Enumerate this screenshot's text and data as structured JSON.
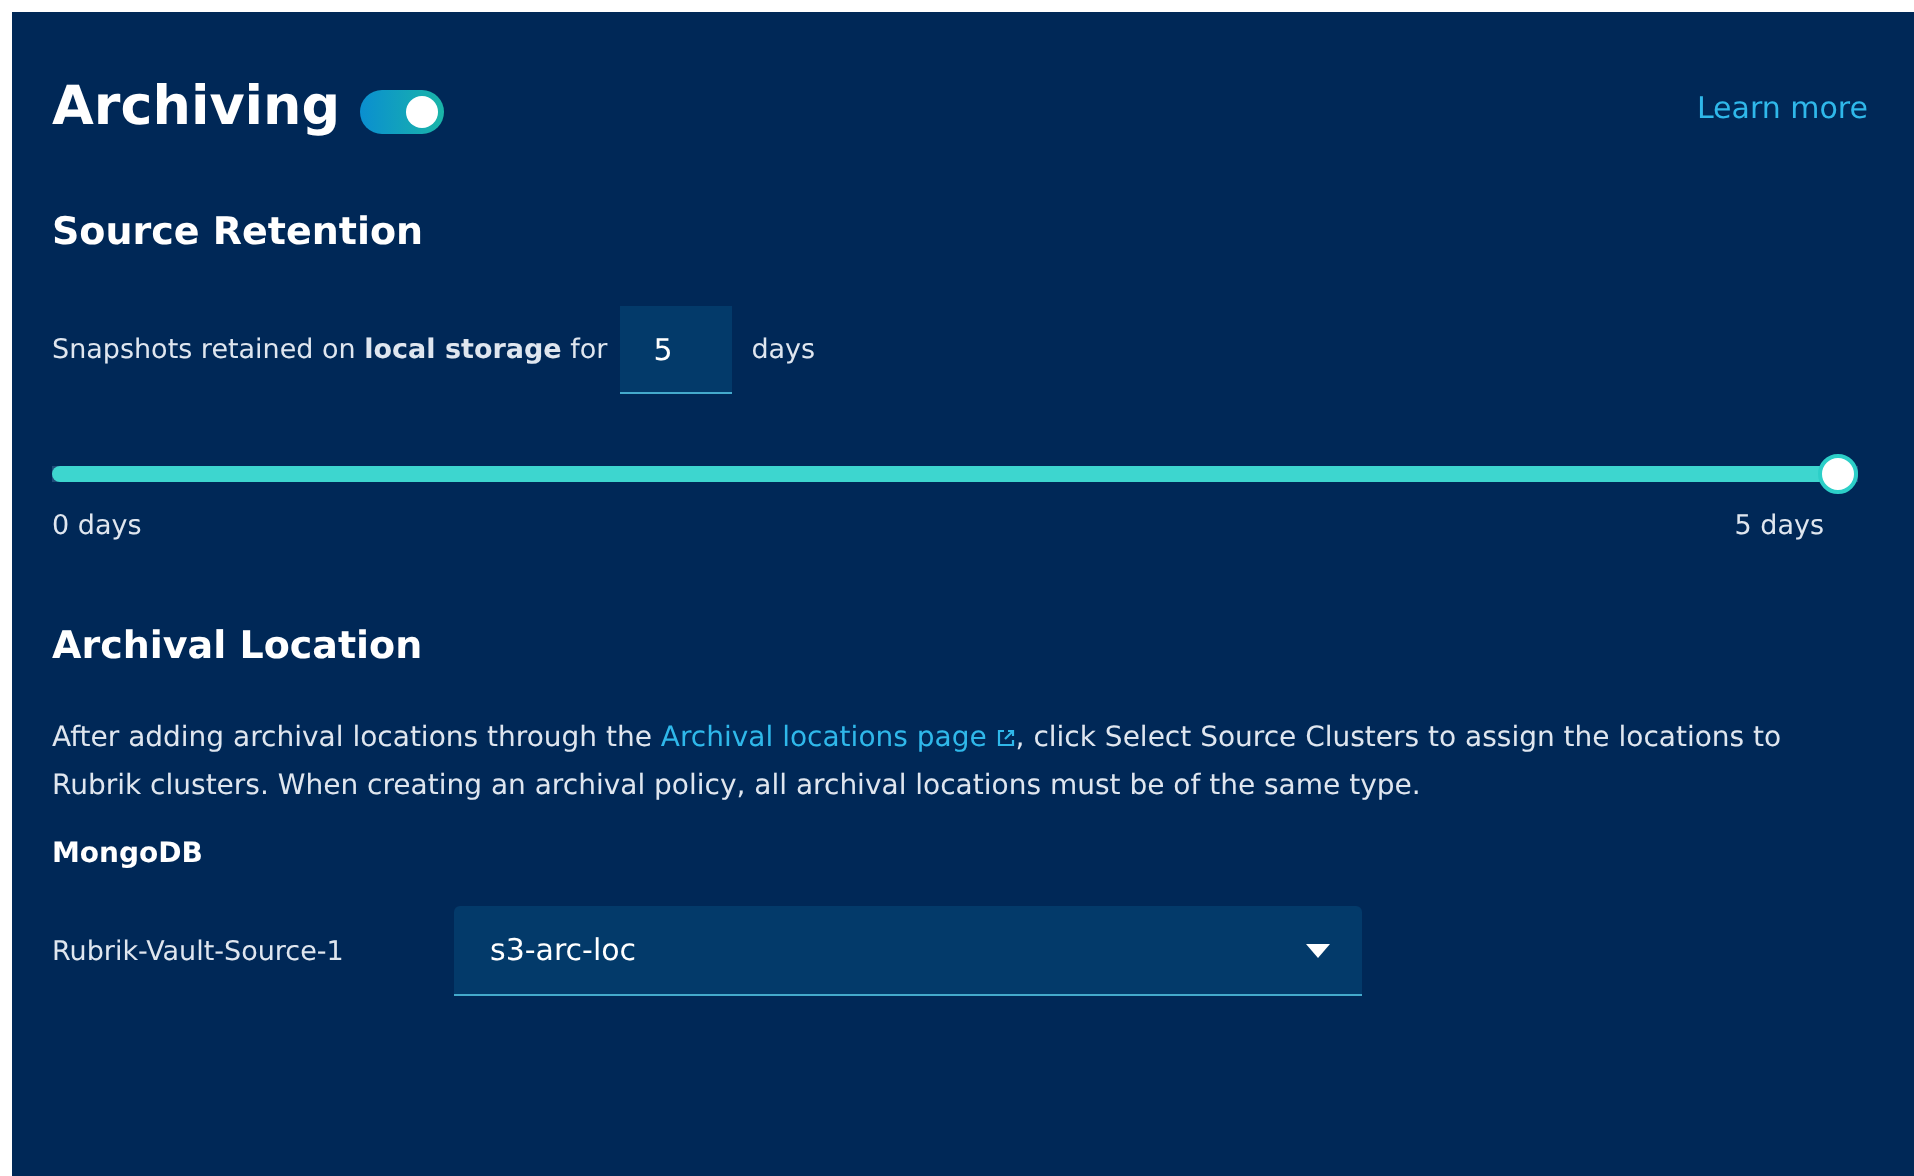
{
  "header": {
    "title": "Archiving",
    "toggle": {
      "on": true
    },
    "learn_more": "Learn more"
  },
  "source_retention": {
    "heading": "Source Retention",
    "sentence": "Snapshots retained on **local storage** for",
    "days_field": {
      "value": "5"
    },
    "unit": "days",
    "slider": {
      "level": 1.0,
      "min_label": "0 days",
      "max_label": "5 days"
    }
  },
  "archival_location": {
    "heading": "Archival Location",
    "description_before": "After adding archival locations through the",
    "description_link": "Archival locations page",
    "description_after": ", click Select Source Clusters to assign the locations to Rubrik clusters. When creating an archival policy, all archival locations must be of the same type.",
    "group": "MongoDB",
    "rows": [
      {
        "cluster": "Rubrik-Vault-Source-1",
        "location": "s3-arc-loc"
      }
    ]
  }
}
